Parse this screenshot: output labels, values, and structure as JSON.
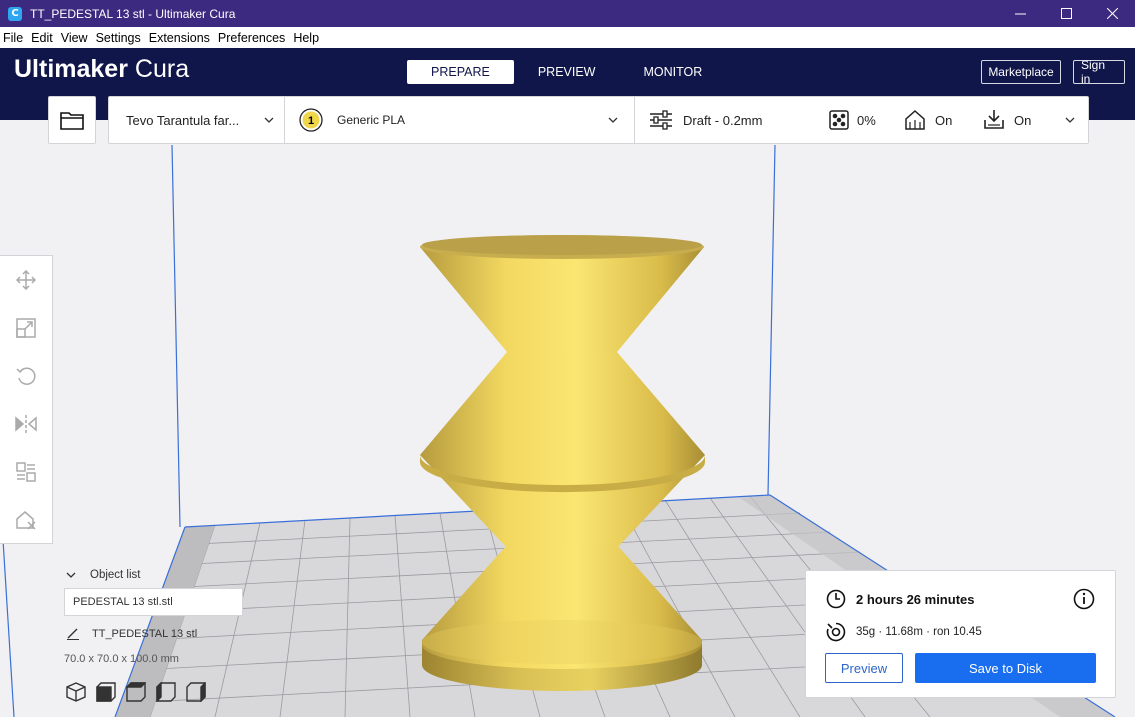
{
  "window": {
    "title": "TT_PEDESTAL 13 stl - Ultimaker Cura",
    "app_icon_letter": "C",
    "controls": [
      "minimize-icon",
      "maximize-icon",
      "close-icon"
    ]
  },
  "menu": [
    "File",
    "Edit",
    "View",
    "Settings",
    "Extensions",
    "Preferences",
    "Help"
  ],
  "header": {
    "logo_bold": "Ultimaker",
    "logo_light": "Cura",
    "stages": [
      "PREPARE",
      "PREVIEW",
      "MONITOR"
    ],
    "active_stage": "PREPARE",
    "marketplace_label": "Marketplace",
    "signin_label": "Sign in"
  },
  "toolbar": {
    "open_icon": "folder-icon",
    "printer": "Tevo Tarantula far...",
    "extruder_number": "1",
    "material": "Generic PLA",
    "profile": "Draft - 0.2mm",
    "infill": "0%",
    "support": "On",
    "adhesion": "On"
  },
  "tools": [
    "move-icon",
    "scale-icon",
    "rotate-icon",
    "mirror-icon",
    "per-model-settings-icon",
    "support-blocker-icon"
  ],
  "object_list": {
    "header": "Object list",
    "selected_file": "PEDESTAL 13 stl.stl",
    "object_name": "TT_PEDESTAL 13 stl",
    "dimensions": "70.0 x 70.0 x 100.0 mm"
  },
  "view_buttons": [
    "3d-view-icon",
    "front-view-icon",
    "top-view-icon",
    "left-view-icon",
    "right-view-icon"
  ],
  "print_summary": {
    "time": "2 hours 26 minutes",
    "material_usage": "35g · 11.68m · ron 10.45",
    "preview_label": "Preview",
    "save_label": "Save to Disk"
  },
  "colors": {
    "title_bar": "#3b2a80",
    "header": "#10154a",
    "accent_blue": "#196ef0",
    "model_yellow": "#f7e06a",
    "build_volume_blue": "#3a6fd8"
  }
}
